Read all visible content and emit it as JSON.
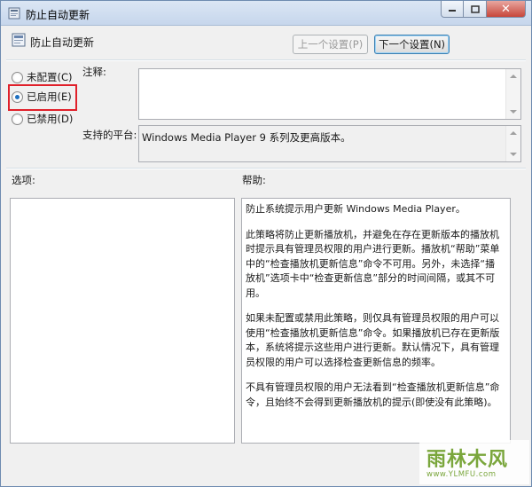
{
  "window": {
    "title": "防止自动更新",
    "icon": "policy-icon",
    "buttons": {
      "minimize": "minimize-icon",
      "maximize": "maximize-icon",
      "close": "close-icon"
    }
  },
  "header": {
    "title": "防止自动更新",
    "prev_button": "上一个设置(P)",
    "next_button": "下一个设置(N)"
  },
  "radios": [
    {
      "label": "未配置(C)",
      "checked": false
    },
    {
      "label": "已启用(E)",
      "checked": true
    },
    {
      "label": "已禁用(D)",
      "checked": false
    }
  ],
  "highlight_color": "#e0202a",
  "comment": {
    "label": "注释:",
    "value": ""
  },
  "platform": {
    "label": "支持的平台:",
    "value": "Windows Media Player 9 系列及更高版本。"
  },
  "options": {
    "label": "选项:"
  },
  "help": {
    "label": "帮助:",
    "paragraphs": [
      "防止系统提示用户更新 Windows Media Player。",
      "此策略将防止更新播放机，并避免在存在更新版本的播放机时提示具有管理员权限的用户进行更新。播放机“帮助”菜单中的“检查播放机更新信息”命令不可用。另外，未选择“播放机”选项卡中“检查更新信息”部分的时间间隔，或其不可用。",
      "如果未配置或禁用此策略，则仅具有管理员权限的用户可以使用“检查播放机更新信息”命令。如果播放机已存在更新版本，系统将提示这些用户进行更新。默认情况下，具有管理员权限的用户可以选择检查更新信息的频率。",
      "不具有管理员权限的用户无法看到“检查播放机更新信息”命令，且始终不会得到更新播放机的提示(即使没有此策略)。"
    ]
  },
  "watermark": {
    "main": "雨林木风",
    "url": "www.YLMFU.com"
  }
}
